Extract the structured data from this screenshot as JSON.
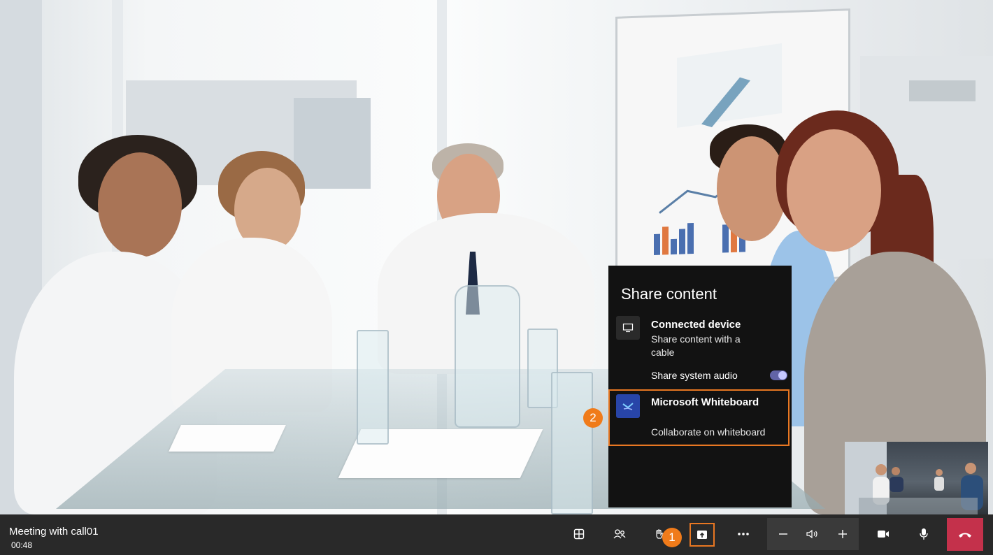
{
  "meeting": {
    "title": "Meeting with call01",
    "elapsed": "00:48"
  },
  "share_panel": {
    "title": "Share content",
    "connected_device": {
      "title": "Connected device",
      "subtitle": "Share content with a cable",
      "icon": "monitor-icon"
    },
    "system_audio": {
      "label": "Share system audio",
      "enabled": true
    },
    "whiteboard": {
      "title": "Microsoft Whiteboard",
      "subtitle": "Collaborate on whiteboard",
      "icon": "whiteboard-icon"
    }
  },
  "callouts": {
    "one": "1",
    "two": "2"
  },
  "toolbar": {
    "buttons": [
      "layout-icon",
      "people-icon",
      "raise-hand-icon",
      "share-screen-icon",
      "more-icon",
      "volume-down-icon",
      "speaker-icon",
      "volume-up-icon",
      "camera-icon",
      "microphone-icon",
      "hang-up-icon"
    ]
  },
  "colors": {
    "accent": "#6264a7",
    "highlight": "#e87722",
    "badge": "#f07b1a",
    "hangup": "#c4314b",
    "whiteboard_tile": "#2845a8"
  }
}
